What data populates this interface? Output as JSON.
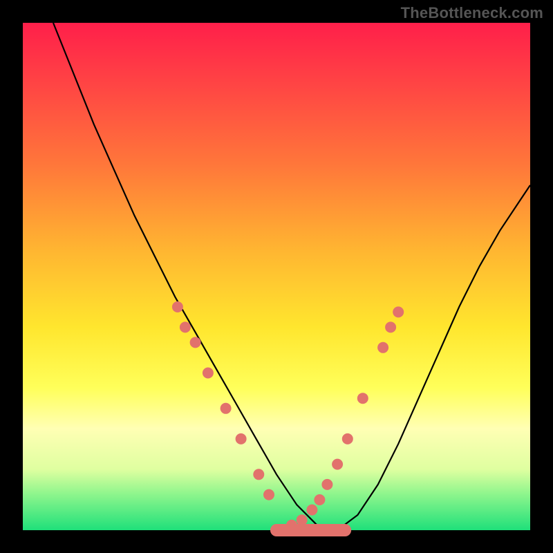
{
  "watermark": "TheBottleneck.com",
  "chart_data": {
    "type": "line",
    "title": "",
    "xlabel": "",
    "ylabel": "",
    "xlim": [
      0,
      100
    ],
    "ylim": [
      0,
      100
    ],
    "grid": false,
    "series": [
      {
        "name": "curve",
        "x": [
          6,
          10,
          14,
          18,
          22,
          26,
          30,
          34,
          38,
          42,
          46,
          50,
          54,
          58,
          62,
          66,
          70,
          74,
          78,
          82,
          86,
          90,
          94,
          98,
          100
        ],
        "y": [
          100,
          90,
          80,
          71,
          62,
          54,
          46,
          39,
          32,
          25,
          18,
          11,
          5,
          1,
          0,
          3,
          9,
          17,
          26,
          35,
          44,
          52,
          59,
          65,
          68
        ]
      }
    ],
    "markers": {
      "left_arm": [
        {
          "x": 30.5,
          "y": 44
        },
        {
          "x": 32.0,
          "y": 40
        },
        {
          "x": 34.0,
          "y": 37
        },
        {
          "x": 36.5,
          "y": 31
        },
        {
          "x": 40.0,
          "y": 24
        },
        {
          "x": 43.0,
          "y": 18
        },
        {
          "x": 46.5,
          "y": 11
        },
        {
          "x": 48.5,
          "y": 7
        }
      ],
      "right_arm": [
        {
          "x": 53.0,
          "y": 1
        },
        {
          "x": 55.0,
          "y": 2
        },
        {
          "x": 57.0,
          "y": 4
        },
        {
          "x": 58.5,
          "y": 6
        },
        {
          "x": 60.0,
          "y": 9
        },
        {
          "x": 62.0,
          "y": 13
        },
        {
          "x": 64.0,
          "y": 18
        },
        {
          "x": 67.0,
          "y": 26
        },
        {
          "x": 71.0,
          "y": 36
        },
        {
          "x": 72.5,
          "y": 40
        },
        {
          "x": 74.0,
          "y": 43
        }
      ],
      "bottom_band": [
        {
          "x": 50.0,
          "y": 0
        },
        {
          "x": 51.5,
          "y": 0
        },
        {
          "x": 53.0,
          "y": 0
        },
        {
          "x": 54.5,
          "y": 0
        },
        {
          "x": 56.0,
          "y": 0
        },
        {
          "x": 57.5,
          "y": 0
        },
        {
          "x": 59.0,
          "y": 0
        },
        {
          "x": 60.5,
          "y": 0
        },
        {
          "x": 62.0,
          "y": 0
        },
        {
          "x": 63.5,
          "y": 0
        }
      ]
    },
    "colors": {
      "curve": "#000000",
      "markers": "#e2726c",
      "background_top": "#ff1f4a",
      "background_bottom": "#1fe07a"
    }
  }
}
